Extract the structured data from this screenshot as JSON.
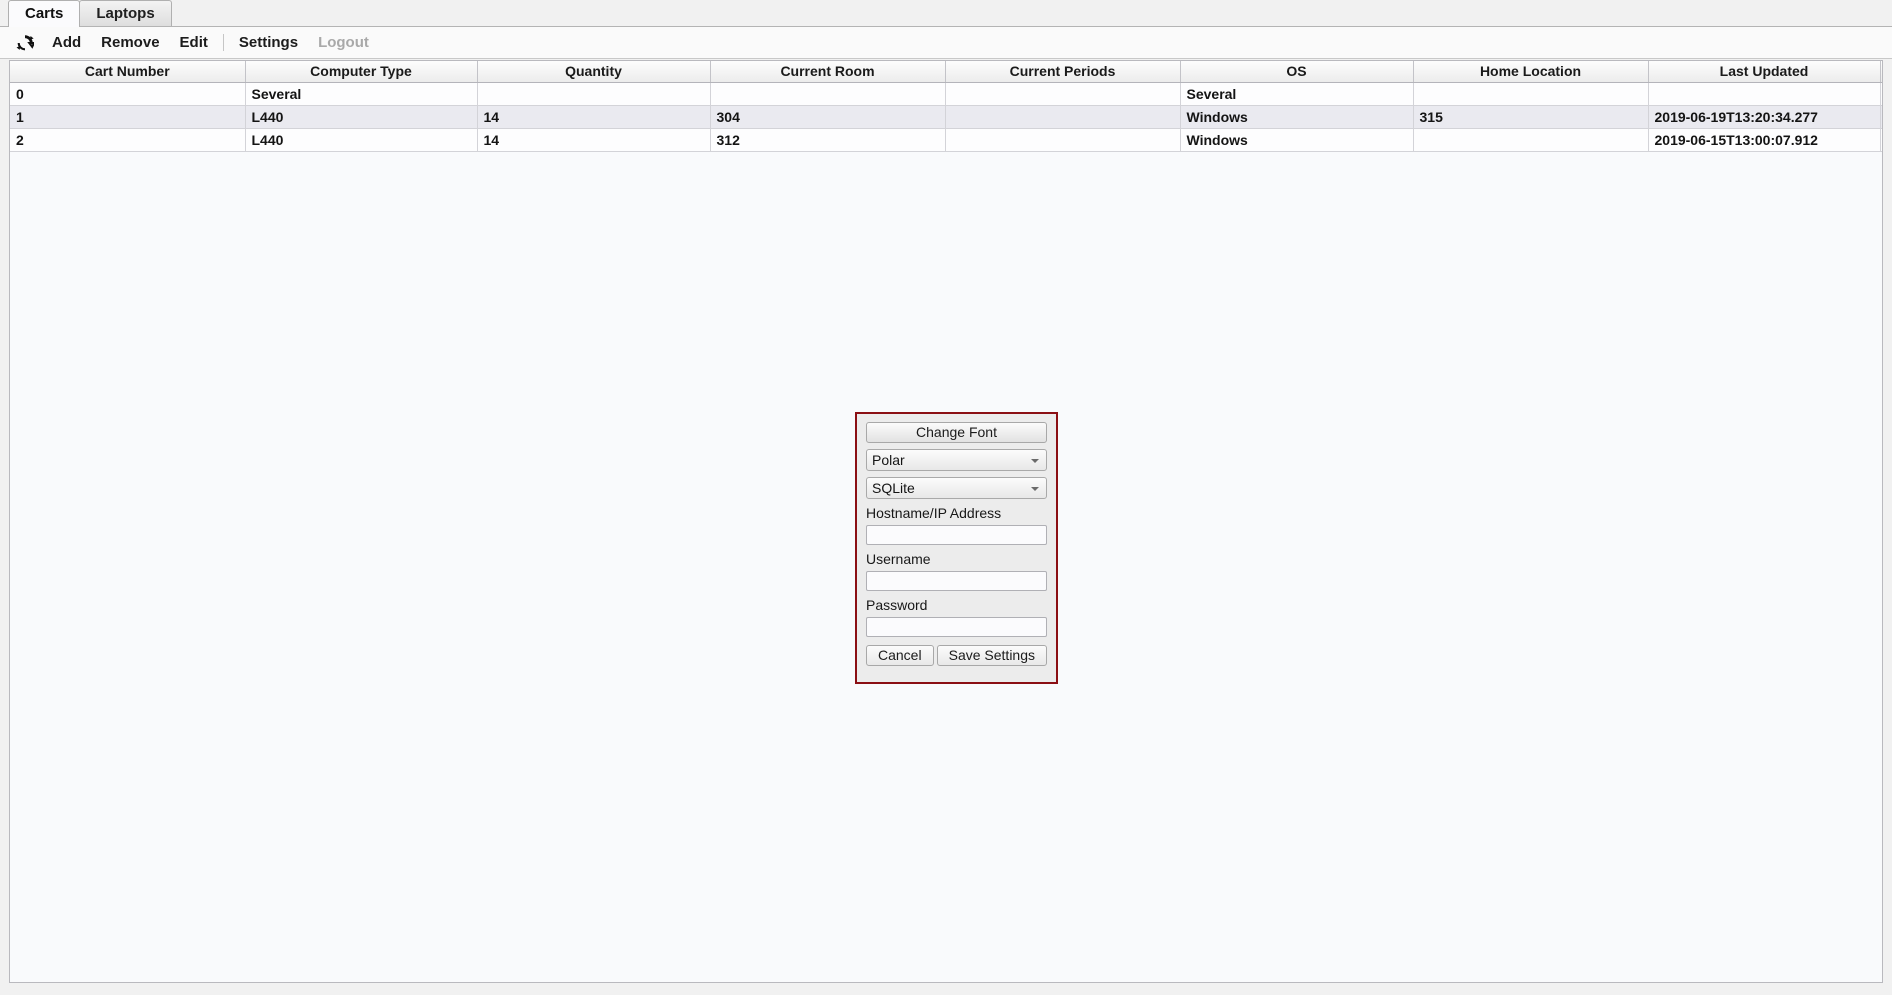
{
  "tabs": [
    {
      "label": "Carts",
      "active": true
    },
    {
      "label": "Laptops",
      "active": false
    }
  ],
  "toolbar": {
    "refresh_icon": "refresh-icon",
    "items": [
      {
        "label": "Add",
        "disabled": false
      },
      {
        "label": "Remove",
        "disabled": false
      },
      {
        "label": "Edit",
        "disabled": false
      },
      {
        "label": "Settings",
        "disabled": false
      },
      {
        "label": "Logout",
        "disabled": true
      }
    ]
  },
  "table": {
    "columns": [
      "Cart Number",
      "Computer Type",
      "Quantity",
      "Current Room",
      "Current Periods",
      "OS",
      "Home Location",
      "Last Updated"
    ],
    "rows": [
      {
        "cells": [
          "0",
          "Several",
          "",
          "",
          "",
          "Several",
          "",
          ""
        ],
        "alt": false
      },
      {
        "cells": [
          "1",
          "L440",
          "14",
          "304",
          "",
          "Windows",
          "315",
          "2019-06-19T13:20:34.277"
        ],
        "alt": true
      },
      {
        "cells": [
          "2",
          "L440",
          "14",
          "312",
          "",
          "Windows",
          "",
          "2019-06-15T13:00:07.912"
        ],
        "alt": false
      }
    ]
  },
  "dialog": {
    "border_color": "#8b0f14",
    "change_font_button": "Change Font",
    "font_select": {
      "value": "Polar",
      "arrow_icon": "chevron-down-icon"
    },
    "database_select": {
      "value": "SQLite",
      "arrow_icon": "chevron-down-icon"
    },
    "hostname_label": "Hostname/IP Address",
    "hostname_value": "",
    "username_label": "Username",
    "username_value": "",
    "password_label": "Password",
    "password_value": "",
    "cancel_button": "Cancel",
    "save_button": "Save Settings"
  }
}
